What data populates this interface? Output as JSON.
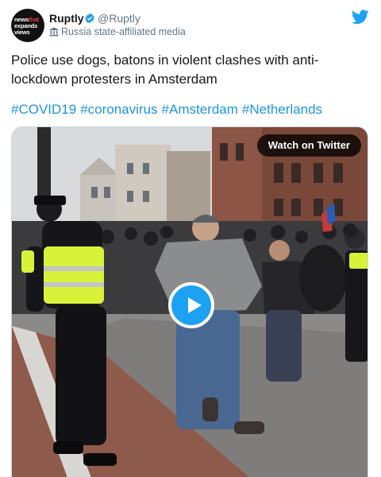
{
  "account": {
    "name": "Ruptly",
    "handle": "@Ruptly",
    "affiliation": "Russia state-affiliated media",
    "avatar_text": [
      "news",
      "that",
      "expands",
      "views"
    ]
  },
  "tweet": {
    "text": "Police use dogs, batons in violent clashes with anti-lockdown protesters in Amsterdam",
    "hashtags": [
      "#COVID19",
      "#coronavirus",
      "#Amsterdam",
      "#Netherlands"
    ]
  },
  "media": {
    "watch_label": "Watch on Twitter"
  },
  "colors": {
    "link": "#1b95e0",
    "twitter_blue": "#1da1f2",
    "police_vest": "#d8f23a"
  }
}
